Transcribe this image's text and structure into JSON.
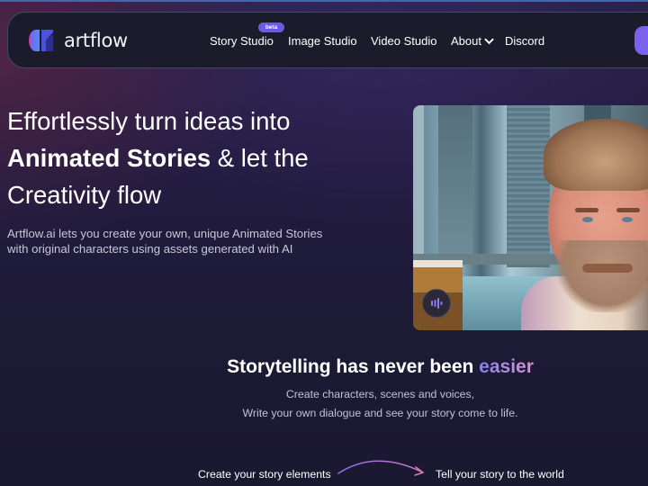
{
  "brand": {
    "name": "artflow",
    "colors": {
      "accent": "#7a62ee",
      "badge": "#6a5ae6",
      "logo_blue": "#4f7df5",
      "logo_pink": "#d43fa0",
      "logo_indigo": "#3b3fb8"
    }
  },
  "nav": {
    "items": [
      {
        "label": "Story Studio",
        "badge": "beta"
      },
      {
        "label": "Image Studio"
      },
      {
        "label": "Video Studio"
      },
      {
        "label": "About",
        "icon": "chevron-down-icon"
      },
      {
        "label": "Discord"
      }
    ],
    "cta_label": ""
  },
  "hero": {
    "title_line1": "Effortlessly turn ideas into",
    "title_bold": "Animated Stories",
    "title_line2_rest": " & let the",
    "title_line3": "Creativity flow",
    "subtitle_line1": "Artflow.ai lets you create your own, unique Animated Stories",
    "subtitle_line2": "with original characters using assets generated with AI",
    "video": {
      "alt": "Animated character portrait",
      "audio_icon": "audio-wave-icon"
    }
  },
  "section": {
    "title_prefix": "Storytelling has never been ",
    "title_accent": "easier",
    "sub_line1": "Create characters, scenes and voices,",
    "sub_line2": "Write your own dialogue and see your story come to life.",
    "step_left": "Create your story elements",
    "step_right": "Tell your story to the world",
    "arrow_icon": "curved-arrow-icon"
  }
}
